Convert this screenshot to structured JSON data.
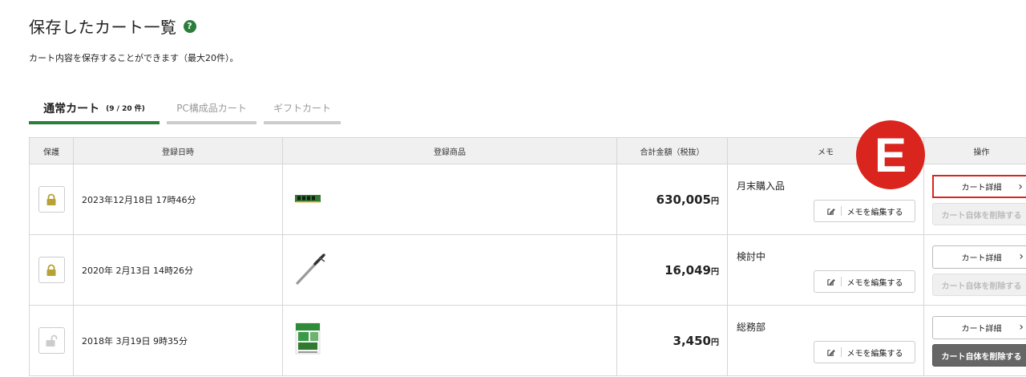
{
  "header": {
    "title": "保存したカート一覧",
    "help_icon": "?",
    "subtitle": "カート内容を保存することができます（最大20件）。"
  },
  "tabs": [
    {
      "label": "通常カート",
      "count": "(9 / 20 件)",
      "active": true
    },
    {
      "label": "PC構成品カート",
      "active": false
    },
    {
      "label": "ギフトカート",
      "active": false
    }
  ],
  "table": {
    "headers": {
      "protect": "保護",
      "date": "登録日時",
      "product": "登録商品",
      "total": "合計金額（税抜）",
      "memo": "メモ",
      "ops": "操作"
    },
    "rows": [
      {
        "locked": true,
        "date": "2023年12月18日 17時46分",
        "product_image": "memory-module",
        "price": "630,005",
        "unit": "円",
        "memo": "月末購入品",
        "edit_memo_label": "メモを編集する",
        "detail_label": "カート詳細",
        "delete_label": "カート自体を削除する",
        "delete_enabled": false,
        "highlight": true
      },
      {
        "locked": true,
        "date": "2020年 2月13日 14時26分",
        "product_image": "pen",
        "price": "16,049",
        "unit": "円",
        "memo": "検討中",
        "edit_memo_label": "メモを編集する",
        "detail_label": "カート詳細",
        "delete_label": "カート自体を削除する",
        "delete_enabled": false,
        "highlight": false
      },
      {
        "locked": false,
        "date": "2018年 3月19日  9時35分",
        "product_image": "product-package",
        "price": "3,450",
        "unit": "円",
        "memo": "総務部",
        "edit_memo_label": "メモを編集する",
        "detail_label": "カート詳細",
        "delete_label": "カート自体を削除する",
        "delete_enabled": true,
        "highlight": false
      }
    ]
  },
  "annotation_badge": "E",
  "colors": {
    "accent_green": "#2a7d3a",
    "lock_gold": "#b8a135",
    "highlight_red": "#d9251d"
  }
}
